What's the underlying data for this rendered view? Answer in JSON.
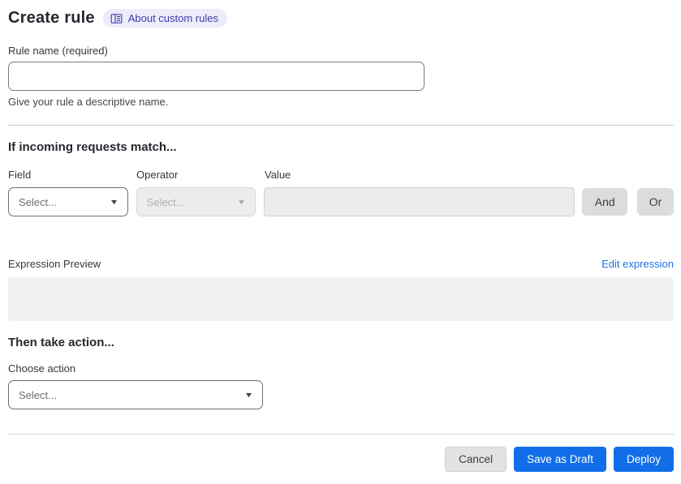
{
  "header": {
    "title": "Create rule",
    "about_link": "About custom rules"
  },
  "rule_name": {
    "label": "Rule name (required)",
    "value": "",
    "helper": "Give your rule a descriptive name."
  },
  "match_section": {
    "heading": "If incoming requests match...",
    "field": {
      "label": "Field",
      "selected": "Select..."
    },
    "operator": {
      "label": "Operator",
      "selected": "Select..."
    },
    "value": {
      "label": "Value",
      "value": ""
    },
    "and_button": "And",
    "or_button": "Or",
    "expression_preview_label": "Expression Preview",
    "edit_expression_link": "Edit expression",
    "expression_value": ""
  },
  "action_section": {
    "heading": "Then take action...",
    "choose_action_label": "Choose action",
    "selected_action": "Select..."
  },
  "footer": {
    "cancel": "Cancel",
    "save_draft": "Save as Draft",
    "deploy": "Deploy"
  },
  "colors": {
    "primary_button": "#116ee8",
    "link": "#1f72e8",
    "badge_bg": "#eeebfa",
    "badge_text": "#3e3ead",
    "disabled_bg": "#ececec",
    "expression_box_bg": "#f1f1f2"
  },
  "icons": {
    "book": "book-icon",
    "caret": "chevron-down-icon"
  }
}
